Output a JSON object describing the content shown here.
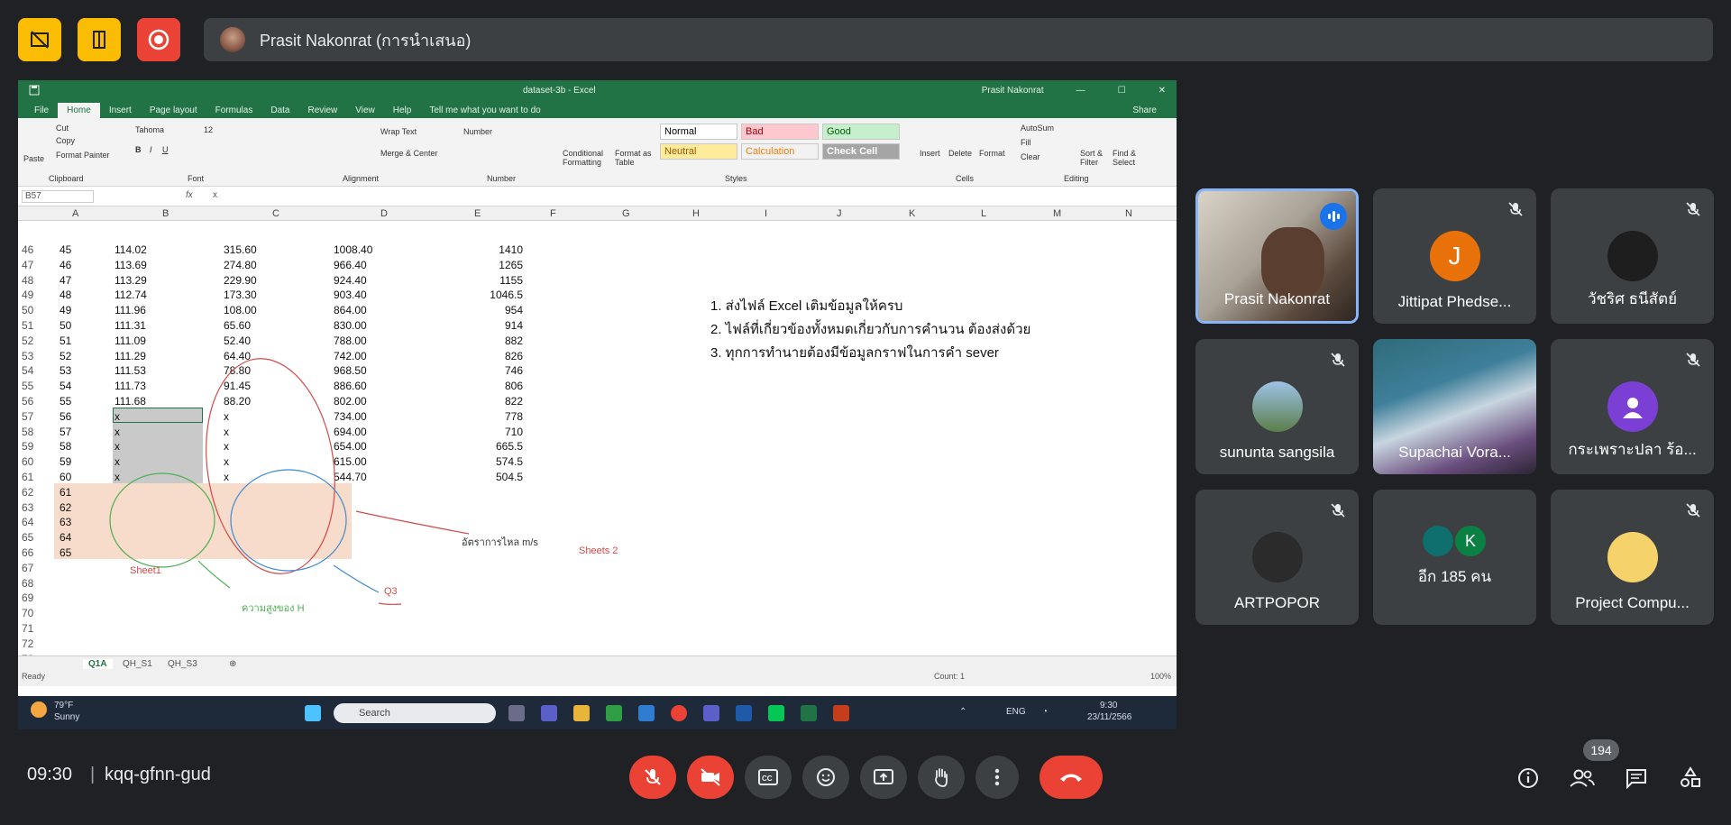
{
  "top_bar": {
    "icons": [
      "no-video-layout-icon",
      "door-exit-icon",
      "record-icon"
    ],
    "presenter_label": "Prasit Nakonrat (การนำเสนอ)"
  },
  "shared_screen": {
    "excel": {
      "doc_title": "dataset-3b - Excel",
      "user": "Prasit Nakonrat",
      "tabs": [
        "File",
        "Home",
        "Insert",
        "Page layout",
        "Formulas",
        "Data",
        "Review",
        "View",
        "Help"
      ],
      "tell_me": "Tell me what you want to do",
      "share": "Share",
      "ribbon": {
        "clipboard": [
          "Paste",
          "Cut",
          "Copy",
          "Format Painter",
          "Clipboard"
        ],
        "font_name": "Tahoma",
        "font_size": "12",
        "font_label": "Font",
        "wrap_text": "Wrap Text",
        "merge_center": "Merge & Center",
        "alignment": "Alignment",
        "number_format": "Number",
        "number_label": "Number",
        "cond_format": "Conditional Formatting",
        "format_table": "Format as Table",
        "styles": [
          "Normal",
          "Bad",
          "Good",
          "Neutral",
          "Calculation",
          "Check Cell"
        ],
        "styles_label": "Styles",
        "cells": [
          "Insert",
          "Delete",
          "Format"
        ],
        "cells_label": "Cells",
        "editing": [
          "AutoSum",
          "Fill",
          "Clear",
          "Sort & Filter",
          "Find & Select"
        ],
        "editing_label": "Editing"
      },
      "name_box": "B57",
      "formula": "x",
      "columns": [
        "A",
        "B",
        "C",
        "D",
        "E",
        "F",
        "G",
        "H",
        "I",
        "J",
        "K",
        "L",
        "M",
        "N"
      ],
      "rows": [
        {
          "r": "46",
          "a": "45",
          "b": "114.02",
          "c": "315.60",
          "d": "1008.40",
          "e": "1410"
        },
        {
          "r": "47",
          "a": "46",
          "b": "113.69",
          "c": "274.80",
          "d": "966.40",
          "e": "1265"
        },
        {
          "r": "48",
          "a": "47",
          "b": "113.29",
          "c": "229.90",
          "d": "924.40",
          "e": "1155"
        },
        {
          "r": "49",
          "a": "48",
          "b": "112.74",
          "c": "173.30",
          "d": "903.40",
          "e": "1046.5"
        },
        {
          "r": "50",
          "a": "49",
          "b": "111.96",
          "c": "108.00",
          "d": "864.00",
          "e": "954"
        },
        {
          "r": "51",
          "a": "50",
          "b": "111.31",
          "c": "65.60",
          "d": "830.00",
          "e": "914"
        },
        {
          "r": "52",
          "a": "51",
          "b": "111.09",
          "c": "52.40",
          "d": "788.00",
          "e": "882"
        },
        {
          "r": "53",
          "a": "52",
          "b": "111.29",
          "c": "64.40",
          "d": "742.00",
          "e": "826"
        },
        {
          "r": "54",
          "a": "53",
          "b": "111.53",
          "c": "78.80",
          "d": "968.50",
          "e": "746"
        },
        {
          "r": "55",
          "a": "54",
          "b": "111.73",
          "c": "91.45",
          "d": "886.60",
          "e": "806"
        },
        {
          "r": "56",
          "a": "55",
          "b": "111.68",
          "c": "88.20",
          "d": "802.00",
          "e": "822"
        },
        {
          "r": "57",
          "a": "56",
          "b": "x",
          "c": "x",
          "d": "734.00",
          "e": "778"
        },
        {
          "r": "58",
          "a": "57",
          "b": "x",
          "c": "x",
          "d": "694.00",
          "e": "710"
        },
        {
          "r": "59",
          "a": "58",
          "b": "x",
          "c": "x",
          "d": "654.00",
          "e": "665.5"
        },
        {
          "r": "60",
          "a": "59",
          "b": "x",
          "c": "x",
          "d": "615.00",
          "e": "574.5"
        },
        {
          "r": "61",
          "a": "60",
          "b": "x",
          "c": "x",
          "d": "544.70",
          "e": "504.5"
        },
        {
          "r": "62",
          "a": "61",
          "b": "",
          "c": "",
          "d": "",
          "e": ""
        },
        {
          "r": "63",
          "a": "62",
          "b": "",
          "c": "",
          "d": "",
          "e": ""
        },
        {
          "r": "64",
          "a": "63",
          "b": "",
          "c": "",
          "d": "",
          "e": ""
        },
        {
          "r": "65",
          "a": "64",
          "b": "",
          "c": "",
          "d": "",
          "e": ""
        },
        {
          "r": "66",
          "a": "65",
          "b": "",
          "c": "",
          "d": "",
          "e": ""
        },
        {
          "r": "67",
          "a": "",
          "b": "",
          "c": "",
          "d": "",
          "e": ""
        },
        {
          "r": "68",
          "a": "",
          "b": "",
          "c": "",
          "d": "",
          "e": ""
        },
        {
          "r": "69",
          "a": "",
          "b": "",
          "c": "",
          "d": "",
          "e": ""
        },
        {
          "r": "70",
          "a": "",
          "b": "",
          "c": "",
          "d": "",
          "e": ""
        },
        {
          "r": "71",
          "a": "",
          "b": "",
          "c": "",
          "d": "",
          "e": ""
        },
        {
          "r": "72",
          "a": "",
          "b": "",
          "c": "",
          "d": "",
          "e": ""
        },
        {
          "r": "73",
          "a": "",
          "b": "",
          "c": "",
          "d": "",
          "e": ""
        }
      ],
      "notes": [
        "1. ส่งไฟล์ Excel เติมข้อมูลให้ครบ",
        "2. ไฟล์ที่เกี่ยวข้องทั้งหมดเกี่ยวกับการคำนวน ต้องส่งด้วย",
        "3. ทุกการทำนายต้องมีข้อมูลกราฟในการคำ sever"
      ],
      "annotations": {
        "flow_rate": "อัตราการไหล m/s",
        "sheets2": "Sheets 2",
        "sheet1": "Sheet1",
        "q3": "Q3",
        "height": "ความสูงของ H"
      },
      "sheet_tabs": [
        "Q1A",
        "QH_S1",
        "QH_S3"
      ],
      "status": "Ready",
      "count": "Count: 1",
      "zoom": "100%"
    },
    "taskbar": {
      "weather_temp": "79°F",
      "weather_desc": "Sunny",
      "search": "Search",
      "lang": "ENG",
      "time": "9:30",
      "date": "23/11/2566"
    }
  },
  "participants": [
    {
      "name": "Prasit Nakonrat",
      "speaking": true
    },
    {
      "name": "Jittipat Phedse...",
      "initial": "J",
      "color": "#e8710a"
    },
    {
      "name": "วัชริศ ธนีสัตย์"
    },
    {
      "name": "sununta sangsila"
    },
    {
      "name": "Supachai Vora..."
    },
    {
      "name": "กระเพราะปลา ร้อ..."
    },
    {
      "name": "ARTPOPOR"
    },
    {
      "name": "อีก 185 คน",
      "initial": "K"
    },
    {
      "name": "Project Compu..."
    }
  ],
  "bottom_bar": {
    "time": "09:30",
    "separator": "|",
    "meeting_code": "kqq-gfnn-gud",
    "participant_count": "194"
  }
}
